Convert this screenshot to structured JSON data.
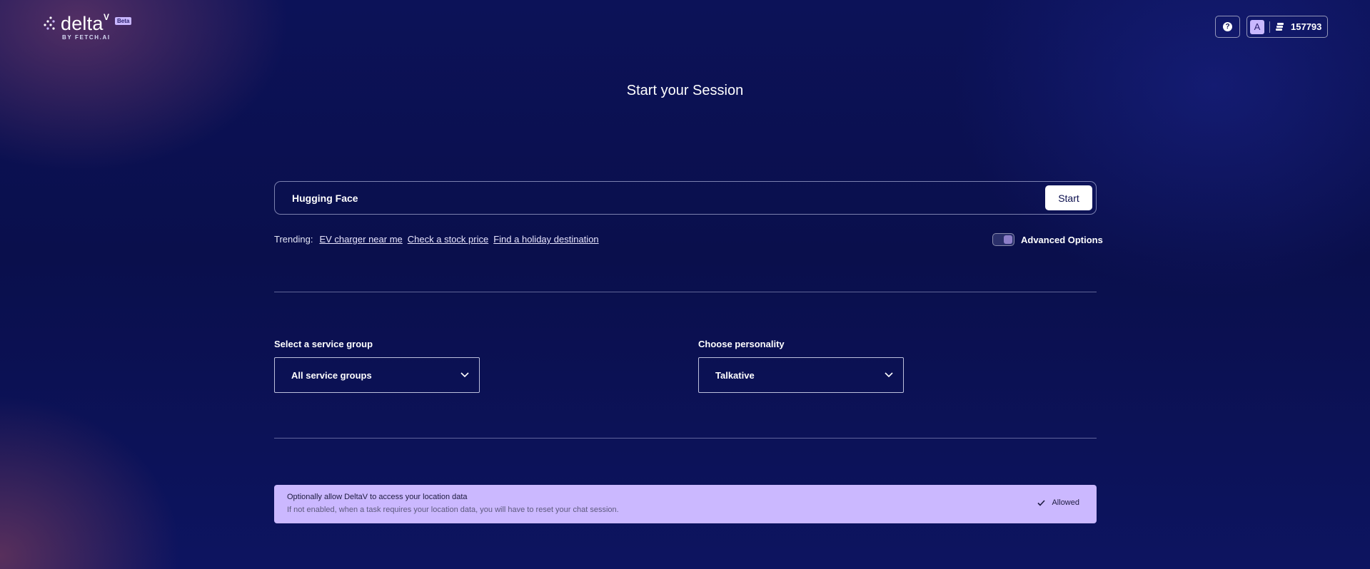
{
  "header": {
    "logo": {
      "wordmark": "delta",
      "superscript": "V",
      "badge": "Beta",
      "byline": "BY FETCH.AI"
    },
    "help_icon_glyph": "?",
    "help_icon": "help-circle-icon",
    "account": {
      "avatar_initial": "A",
      "coins_icon": "coins-stack-icon",
      "credits": "157793"
    }
  },
  "main": {
    "title": "Start your Session",
    "search": {
      "value": "Hugging Face",
      "start_label": "Start"
    },
    "trending": {
      "label": "Trending:",
      "links": [
        "EV charger near me",
        "Check a stock price",
        "Find a holiday destination"
      ]
    },
    "advanced_options": {
      "label": "Advanced Options",
      "enabled": true
    },
    "service_group": {
      "label": "Select a service group",
      "value": "All service groups"
    },
    "personality": {
      "label": "Choose personality",
      "value": "Talkative"
    },
    "location": {
      "title": "Optionally allow DeltaV to access your location data",
      "description": "If not enabled, when a task requires your location data, you will have to reset your chat session.",
      "status_label": "Allowed"
    }
  },
  "colors": {
    "background": "#0b0f4e",
    "accent_lavender": "#cbb8ff",
    "text_white": "#ffffff"
  }
}
